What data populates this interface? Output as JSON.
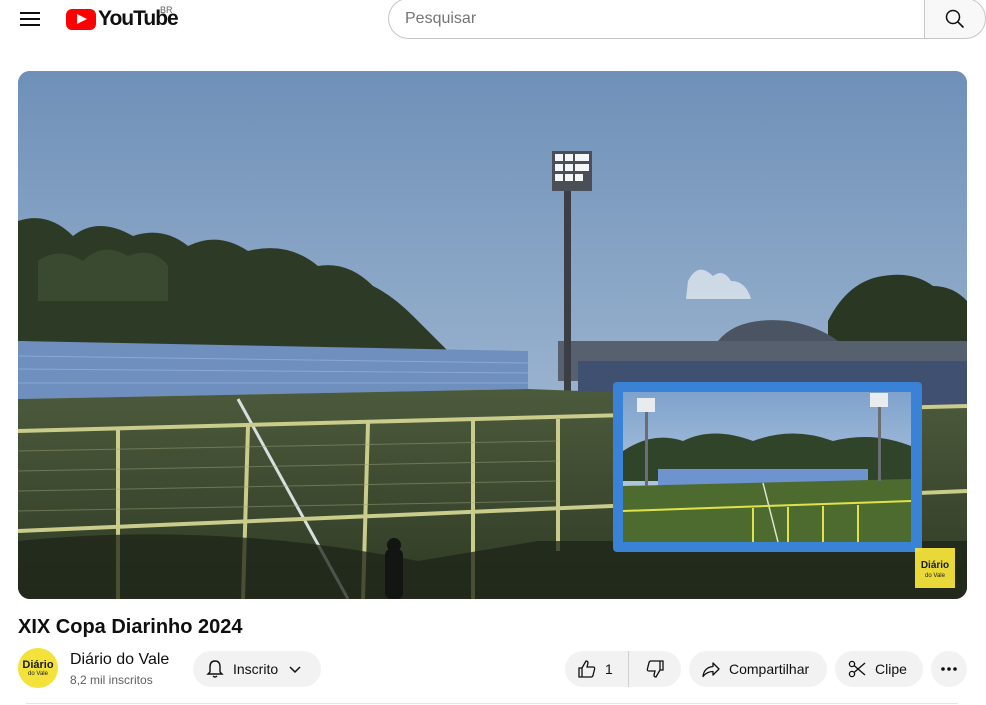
{
  "header": {
    "logo_text": "YouTube",
    "country_code": "BR",
    "search_placeholder": "Pesquisar"
  },
  "video": {
    "title": "XIX Copa Diarinho 2024",
    "watermark_line1": "Diário",
    "watermark_line2": "do Vale"
  },
  "channel": {
    "name": "Diário do Vale",
    "subscribers": "8,2 mil inscritos",
    "avatar_line1": "Diário",
    "avatar_line2": "do Vale"
  },
  "actions": {
    "subscribed_label": "Inscrito",
    "like_count": "1",
    "share_label": "Compartilhar",
    "clip_label": "Clipe"
  },
  "colors": {
    "brand_red": "#ff0000",
    "pip_frame": "#3a82d6",
    "avatar_yellow": "#f3e23a"
  }
}
